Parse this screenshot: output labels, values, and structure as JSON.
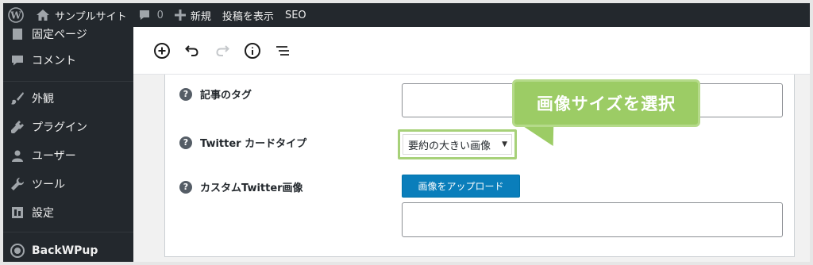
{
  "admin_bar": {
    "site_name": "サンプルサイト",
    "comment_count": "0",
    "new_label": "新規",
    "view_post_label": "投稿を表示",
    "seo_label": "SEO"
  },
  "sidebar": {
    "items": [
      {
        "label": "固定ページ",
        "icon": "page-icon"
      },
      {
        "label": "コメント",
        "icon": "comment-icon"
      },
      {
        "label": "外観",
        "icon": "brush-icon"
      },
      {
        "label": "プラグイン",
        "icon": "plugin-icon"
      },
      {
        "label": "ユーザー",
        "icon": "user-icon"
      },
      {
        "label": "ツール",
        "icon": "wrench-icon"
      },
      {
        "label": "設定",
        "icon": "settings-icon"
      },
      {
        "label": "BackWPup",
        "icon": "backwpup-icon"
      }
    ]
  },
  "toolbar": {
    "buttons": [
      "add-block-icon",
      "undo-icon",
      "redo-icon",
      "info-icon",
      "outline-icon"
    ]
  },
  "fields": {
    "tags_label": "記事のタグ",
    "tags_value": "",
    "card_type_label": "Twitter カードタイプ",
    "card_type_value": "要約の大きい画像",
    "custom_image_label": "カスタムTwitter画像",
    "upload_button": "画像をアップロード",
    "custom_image_value": ""
  },
  "callout": {
    "text": "画像サイズを選択",
    "color": "#9ccc65"
  }
}
